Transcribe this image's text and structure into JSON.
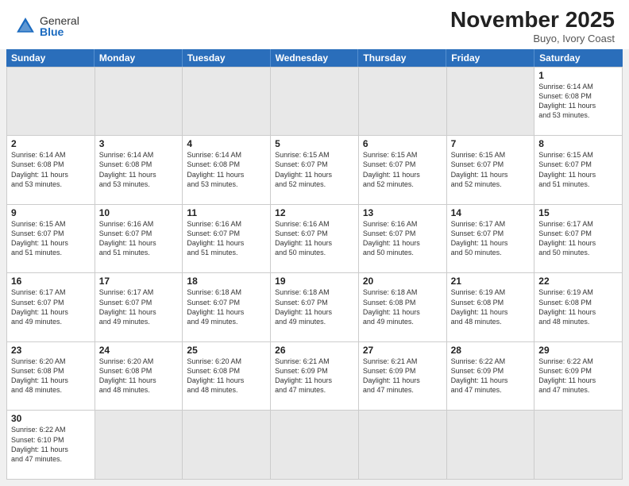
{
  "header": {
    "logo_general": "General",
    "logo_blue": "Blue",
    "month_title": "November 2025",
    "location": "Buyo, Ivory Coast"
  },
  "day_headers": [
    "Sunday",
    "Monday",
    "Tuesday",
    "Wednesday",
    "Thursday",
    "Friday",
    "Saturday"
  ],
  "cells": [
    {
      "day": "",
      "empty": true,
      "info": ""
    },
    {
      "day": "",
      "empty": true,
      "info": ""
    },
    {
      "day": "",
      "empty": true,
      "info": ""
    },
    {
      "day": "",
      "empty": true,
      "info": ""
    },
    {
      "day": "",
      "empty": true,
      "info": ""
    },
    {
      "day": "",
      "empty": true,
      "info": ""
    },
    {
      "day": "1",
      "empty": false,
      "info": "Sunrise: 6:14 AM\nSunset: 6:08 PM\nDaylight: 11 hours\nand 53 minutes."
    },
    {
      "day": "2",
      "empty": false,
      "info": "Sunrise: 6:14 AM\nSunset: 6:08 PM\nDaylight: 11 hours\nand 53 minutes."
    },
    {
      "day": "3",
      "empty": false,
      "info": "Sunrise: 6:14 AM\nSunset: 6:08 PM\nDaylight: 11 hours\nand 53 minutes."
    },
    {
      "day": "4",
      "empty": false,
      "info": "Sunrise: 6:14 AM\nSunset: 6:08 PM\nDaylight: 11 hours\nand 53 minutes."
    },
    {
      "day": "5",
      "empty": false,
      "info": "Sunrise: 6:15 AM\nSunset: 6:07 PM\nDaylight: 11 hours\nand 52 minutes."
    },
    {
      "day": "6",
      "empty": false,
      "info": "Sunrise: 6:15 AM\nSunset: 6:07 PM\nDaylight: 11 hours\nand 52 minutes."
    },
    {
      "day": "7",
      "empty": false,
      "info": "Sunrise: 6:15 AM\nSunset: 6:07 PM\nDaylight: 11 hours\nand 52 minutes."
    },
    {
      "day": "8",
      "empty": false,
      "info": "Sunrise: 6:15 AM\nSunset: 6:07 PM\nDaylight: 11 hours\nand 51 minutes."
    },
    {
      "day": "9",
      "empty": false,
      "info": "Sunrise: 6:15 AM\nSunset: 6:07 PM\nDaylight: 11 hours\nand 51 minutes."
    },
    {
      "day": "10",
      "empty": false,
      "info": "Sunrise: 6:16 AM\nSunset: 6:07 PM\nDaylight: 11 hours\nand 51 minutes."
    },
    {
      "day": "11",
      "empty": false,
      "info": "Sunrise: 6:16 AM\nSunset: 6:07 PM\nDaylight: 11 hours\nand 51 minutes."
    },
    {
      "day": "12",
      "empty": false,
      "info": "Sunrise: 6:16 AM\nSunset: 6:07 PM\nDaylight: 11 hours\nand 50 minutes."
    },
    {
      "day": "13",
      "empty": false,
      "info": "Sunrise: 6:16 AM\nSunset: 6:07 PM\nDaylight: 11 hours\nand 50 minutes."
    },
    {
      "day": "14",
      "empty": false,
      "info": "Sunrise: 6:17 AM\nSunset: 6:07 PM\nDaylight: 11 hours\nand 50 minutes."
    },
    {
      "day": "15",
      "empty": false,
      "info": "Sunrise: 6:17 AM\nSunset: 6:07 PM\nDaylight: 11 hours\nand 50 minutes."
    },
    {
      "day": "16",
      "empty": false,
      "info": "Sunrise: 6:17 AM\nSunset: 6:07 PM\nDaylight: 11 hours\nand 49 minutes."
    },
    {
      "day": "17",
      "empty": false,
      "info": "Sunrise: 6:17 AM\nSunset: 6:07 PM\nDaylight: 11 hours\nand 49 minutes."
    },
    {
      "day": "18",
      "empty": false,
      "info": "Sunrise: 6:18 AM\nSunset: 6:07 PM\nDaylight: 11 hours\nand 49 minutes."
    },
    {
      "day": "19",
      "empty": false,
      "info": "Sunrise: 6:18 AM\nSunset: 6:07 PM\nDaylight: 11 hours\nand 49 minutes."
    },
    {
      "day": "20",
      "empty": false,
      "info": "Sunrise: 6:18 AM\nSunset: 6:08 PM\nDaylight: 11 hours\nand 49 minutes."
    },
    {
      "day": "21",
      "empty": false,
      "info": "Sunrise: 6:19 AM\nSunset: 6:08 PM\nDaylight: 11 hours\nand 48 minutes."
    },
    {
      "day": "22",
      "empty": false,
      "info": "Sunrise: 6:19 AM\nSunset: 6:08 PM\nDaylight: 11 hours\nand 48 minutes."
    },
    {
      "day": "23",
      "empty": false,
      "info": "Sunrise: 6:20 AM\nSunset: 6:08 PM\nDaylight: 11 hours\nand 48 minutes."
    },
    {
      "day": "24",
      "empty": false,
      "info": "Sunrise: 6:20 AM\nSunset: 6:08 PM\nDaylight: 11 hours\nand 48 minutes."
    },
    {
      "day": "25",
      "empty": false,
      "info": "Sunrise: 6:20 AM\nSunset: 6:08 PM\nDaylight: 11 hours\nand 48 minutes."
    },
    {
      "day": "26",
      "empty": false,
      "info": "Sunrise: 6:21 AM\nSunset: 6:09 PM\nDaylight: 11 hours\nand 47 minutes."
    },
    {
      "day": "27",
      "empty": false,
      "info": "Sunrise: 6:21 AM\nSunset: 6:09 PM\nDaylight: 11 hours\nand 47 minutes."
    },
    {
      "day": "28",
      "empty": false,
      "info": "Sunrise: 6:22 AM\nSunset: 6:09 PM\nDaylight: 11 hours\nand 47 minutes."
    },
    {
      "day": "29",
      "empty": false,
      "info": "Sunrise: 6:22 AM\nSunset: 6:09 PM\nDaylight: 11 hours\nand 47 minutes."
    },
    {
      "day": "30",
      "empty": false,
      "info": "Sunrise: 6:22 AM\nSunset: 6:10 PM\nDaylight: 11 hours\nand 47 minutes."
    },
    {
      "day": "",
      "empty": true,
      "info": ""
    },
    {
      "day": "",
      "empty": true,
      "info": ""
    },
    {
      "day": "",
      "empty": true,
      "info": ""
    },
    {
      "day": "",
      "empty": true,
      "info": ""
    },
    {
      "day": "",
      "empty": true,
      "info": ""
    },
    {
      "day": "",
      "empty": true,
      "info": ""
    }
  ]
}
